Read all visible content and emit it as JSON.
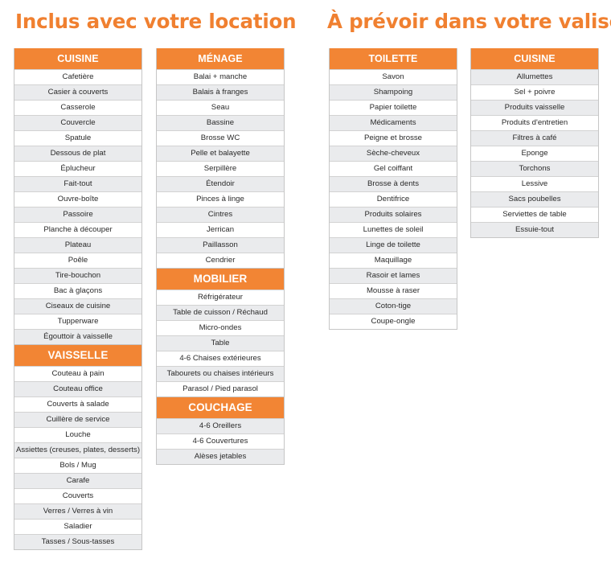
{
  "titles": {
    "left": "Inclus avec votre location",
    "right": "À prévoir dans votre valise"
  },
  "colors": {
    "accent": "#f28534",
    "row_gray": "#eaebed",
    "row_light": "#ffffff"
  },
  "columns": [
    {
      "sections": [
        {
          "header": "CUISINE",
          "items": [
            {
              "label": "Cafetière",
              "shade": "light"
            },
            {
              "label": "Casier à couverts",
              "shade": "gray"
            },
            {
              "label": "Casserole",
              "shade": "light"
            },
            {
              "label": "Couvercle",
              "shade": "gray"
            },
            {
              "label": "Spatule",
              "shade": "light"
            },
            {
              "label": "Dessous de plat",
              "shade": "gray"
            },
            {
              "label": "Éplucheur",
              "shade": "light"
            },
            {
              "label": "Fait-tout",
              "shade": "gray"
            },
            {
              "label": "Ouvre-boîte",
              "shade": "light"
            },
            {
              "label": "Passoire",
              "shade": "gray"
            },
            {
              "label": "Planche à découper",
              "shade": "light"
            },
            {
              "label": "Plateau",
              "shade": "gray"
            },
            {
              "label": "Poêle",
              "shade": "light"
            },
            {
              "label": "Tire-bouchon",
              "shade": "gray"
            },
            {
              "label": "Bac à glaçons",
              "shade": "light"
            },
            {
              "label": "Ciseaux de cuisine",
              "shade": "gray"
            },
            {
              "label": "Tupperware",
              "shade": "light"
            },
            {
              "label": "Égouttoir à vaisselle",
              "shade": "gray"
            }
          ]
        },
        {
          "header": "VAISSELLE",
          "items": [
            {
              "label": "Couteau à pain",
              "shade": "light"
            },
            {
              "label": "Couteau office",
              "shade": "gray"
            },
            {
              "label": "Couverts à salade",
              "shade": "light"
            },
            {
              "label": "Cuillère de service",
              "shade": "gray"
            },
            {
              "label": "Louche",
              "shade": "light"
            },
            {
              "label": "Assiettes (creuses, plates, desserts)",
              "shade": "gray"
            },
            {
              "label": "Bols / Mug",
              "shade": "light"
            },
            {
              "label": "Carafe",
              "shade": "gray"
            },
            {
              "label": "Couverts",
              "shade": "light"
            },
            {
              "label": "Verres / Verres à vin",
              "shade": "gray"
            },
            {
              "label": "Saladier",
              "shade": "light"
            },
            {
              "label": "Tasses / Sous-tasses",
              "shade": "gray"
            }
          ]
        }
      ]
    },
    {
      "sections": [
        {
          "header": "MÉNAGE",
          "items": [
            {
              "label": "Balai + manche",
              "shade": "light"
            },
            {
              "label": "Balais à franges",
              "shade": "gray"
            },
            {
              "label": "Seau",
              "shade": "light"
            },
            {
              "label": "Bassine",
              "shade": "gray"
            },
            {
              "label": "Brosse WC",
              "shade": "light"
            },
            {
              "label": "Pelle et balayette",
              "shade": "gray"
            },
            {
              "label": "Serpillère",
              "shade": "light"
            },
            {
              "label": "Étendoir",
              "shade": "gray"
            },
            {
              "label": "Pinces à linge",
              "shade": "light"
            },
            {
              "label": "Cintres",
              "shade": "gray"
            },
            {
              "label": "Jerrican",
              "shade": "light"
            },
            {
              "label": "Paillasson",
              "shade": "gray"
            },
            {
              "label": "Cendrier",
              "shade": "light"
            }
          ]
        },
        {
          "header": "MOBILIER",
          "items": [
            {
              "label": "Réfrigérateur",
              "shade": "light"
            },
            {
              "label": "Table de cuisson / Réchaud",
              "shade": "gray"
            },
            {
              "label": "Micro-ondes",
              "shade": "light"
            },
            {
              "label": "Table",
              "shade": "gray"
            },
            {
              "label": "4-6 Chaises extérieures",
              "shade": "light"
            },
            {
              "label": "Tabourets ou chaises intérieurs",
              "shade": "gray"
            },
            {
              "label": "Parasol / Pied parasol",
              "shade": "light"
            }
          ]
        },
        {
          "header": "COUCHAGE",
          "items": [
            {
              "label": "4-6 Oreillers",
              "shade": "gray"
            },
            {
              "label": "4-6 Couvertures",
              "shade": "light"
            },
            {
              "label": "Alèses jetables",
              "shade": "gray"
            }
          ]
        }
      ]
    },
    {
      "sections": [
        {
          "header": "TOILETTE",
          "items": [
            {
              "label": "Savon",
              "shade": "light"
            },
            {
              "label": "Shampoing",
              "shade": "gray"
            },
            {
              "label": "Papier toilette",
              "shade": "light"
            },
            {
              "label": "Médicaments",
              "shade": "gray"
            },
            {
              "label": "Peigne et brosse",
              "shade": "light"
            },
            {
              "label": "Sèche-cheveux",
              "shade": "gray"
            },
            {
              "label": "Gel coiffant",
              "shade": "light"
            },
            {
              "label": "Brosse à dents",
              "shade": "gray"
            },
            {
              "label": "Dentifrice",
              "shade": "light"
            },
            {
              "label": "Produits solaires",
              "shade": "gray"
            },
            {
              "label": "Lunettes de soleil",
              "shade": "light"
            },
            {
              "label": "Linge de toilette",
              "shade": "gray"
            },
            {
              "label": "Maquillage",
              "shade": "light"
            },
            {
              "label": "Rasoir et lames",
              "shade": "gray"
            },
            {
              "label": "Mousse à raser",
              "shade": "light"
            },
            {
              "label": "Coton-tige",
              "shade": "gray"
            },
            {
              "label": "Coupe-ongle",
              "shade": "light"
            }
          ]
        }
      ]
    },
    {
      "sections": [
        {
          "header": "CUISINE",
          "items": [
            {
              "label": "Allumettes",
              "shade": "gray"
            },
            {
              "label": "Sel + poivre",
              "shade": "light"
            },
            {
              "label": "Produits vaisselle",
              "shade": "gray"
            },
            {
              "label": "Produits d'entretien",
              "shade": "light"
            },
            {
              "label": "Filtres à café",
              "shade": "gray"
            },
            {
              "label": "Eponge",
              "shade": "light"
            },
            {
              "label": "Torchons",
              "shade": "gray"
            },
            {
              "label": "Lessive",
              "shade": "light"
            },
            {
              "label": "Sacs poubelles",
              "shade": "gray"
            },
            {
              "label": "Serviettes de table",
              "shade": "light"
            },
            {
              "label": "Essuie-tout",
              "shade": "gray"
            }
          ]
        }
      ]
    }
  ]
}
